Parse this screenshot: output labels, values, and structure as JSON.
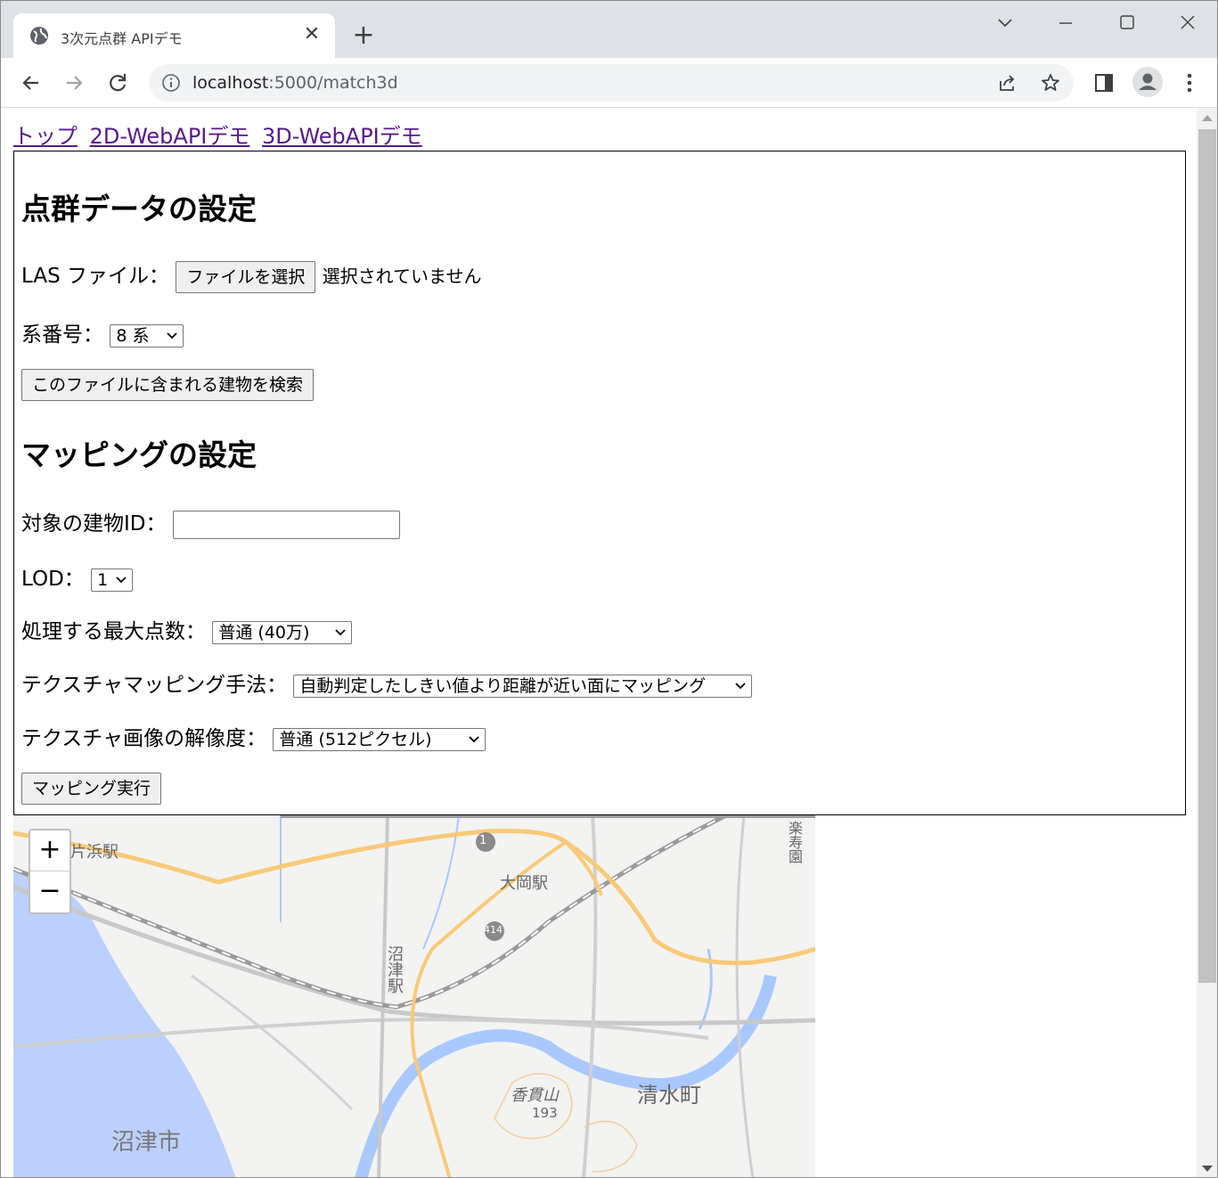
{
  "browser": {
    "tab_title": "3次元点群 APIデモ",
    "url_host": "localhost",
    "url_path": ":5000/match3d"
  },
  "nav": {
    "links": [
      "トップ",
      "2D-WebAPIデモ",
      "3D-WebAPIデモ"
    ]
  },
  "pointcloud": {
    "heading": "点群データの設定",
    "las_label": "LAS ファイル：",
    "file_button": "ファイルを選択",
    "file_status": "選択されていません",
    "zone_label": "系番号：",
    "zone_value": "8 系",
    "search_button": "このファイルに含まれる建物を検索"
  },
  "mapping": {
    "heading": "マッピングの設定",
    "building_id_label": "対象の建物ID：",
    "building_id_value": "",
    "lod_label": "LOD：",
    "lod_value": "1",
    "max_points_label": "処理する最大点数：",
    "max_points_value": "普通 (40万)",
    "method_label": "テクスチャマッピング手法：",
    "method_value": "自動判定したしきい値より距離が近い面にマッピング",
    "resolution_label": "テクスチャ画像の解像度：",
    "resolution_value": "普通 (512ピクセル)",
    "run_button": "マッピング実行"
  },
  "map": {
    "zoom_in": "+",
    "zoom_out": "−",
    "labels": [
      "片浜駅",
      "大岡駅",
      "沼津駅",
      "香貫山",
      "193",
      "清水町",
      "沼津市",
      "楽寿園",
      "1",
      "414"
    ]
  },
  "colors": {
    "link": "#551a8b",
    "sea": "#bcd0ff",
    "road_major": "#f8c978",
    "rail": "#9a9a9a",
    "river": "#a8c8ff"
  }
}
